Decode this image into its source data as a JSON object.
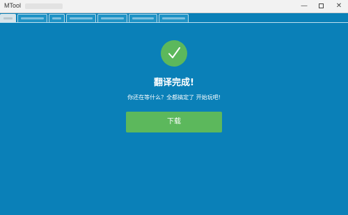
{
  "window": {
    "title": "MTool",
    "minimize_glyph": "—",
    "close_glyph": "✕"
  },
  "tabs": [
    {
      "label": "",
      "active": true
    },
    {
      "label": "",
      "active": false
    },
    {
      "label": "",
      "active": false
    },
    {
      "label": "",
      "active": false
    },
    {
      "label": "",
      "active": false
    },
    {
      "label": "",
      "active": false
    },
    {
      "label": "",
      "active": false
    }
  ],
  "result": {
    "icon": "check-icon",
    "heading": "翻译完成!",
    "message": "你还在等什么？全都搞定了 开始玩吧!",
    "download_label": "下载"
  },
  "colors": {
    "background": "#0a80b8",
    "success": "#5cb85c",
    "text": "#ffffff"
  }
}
